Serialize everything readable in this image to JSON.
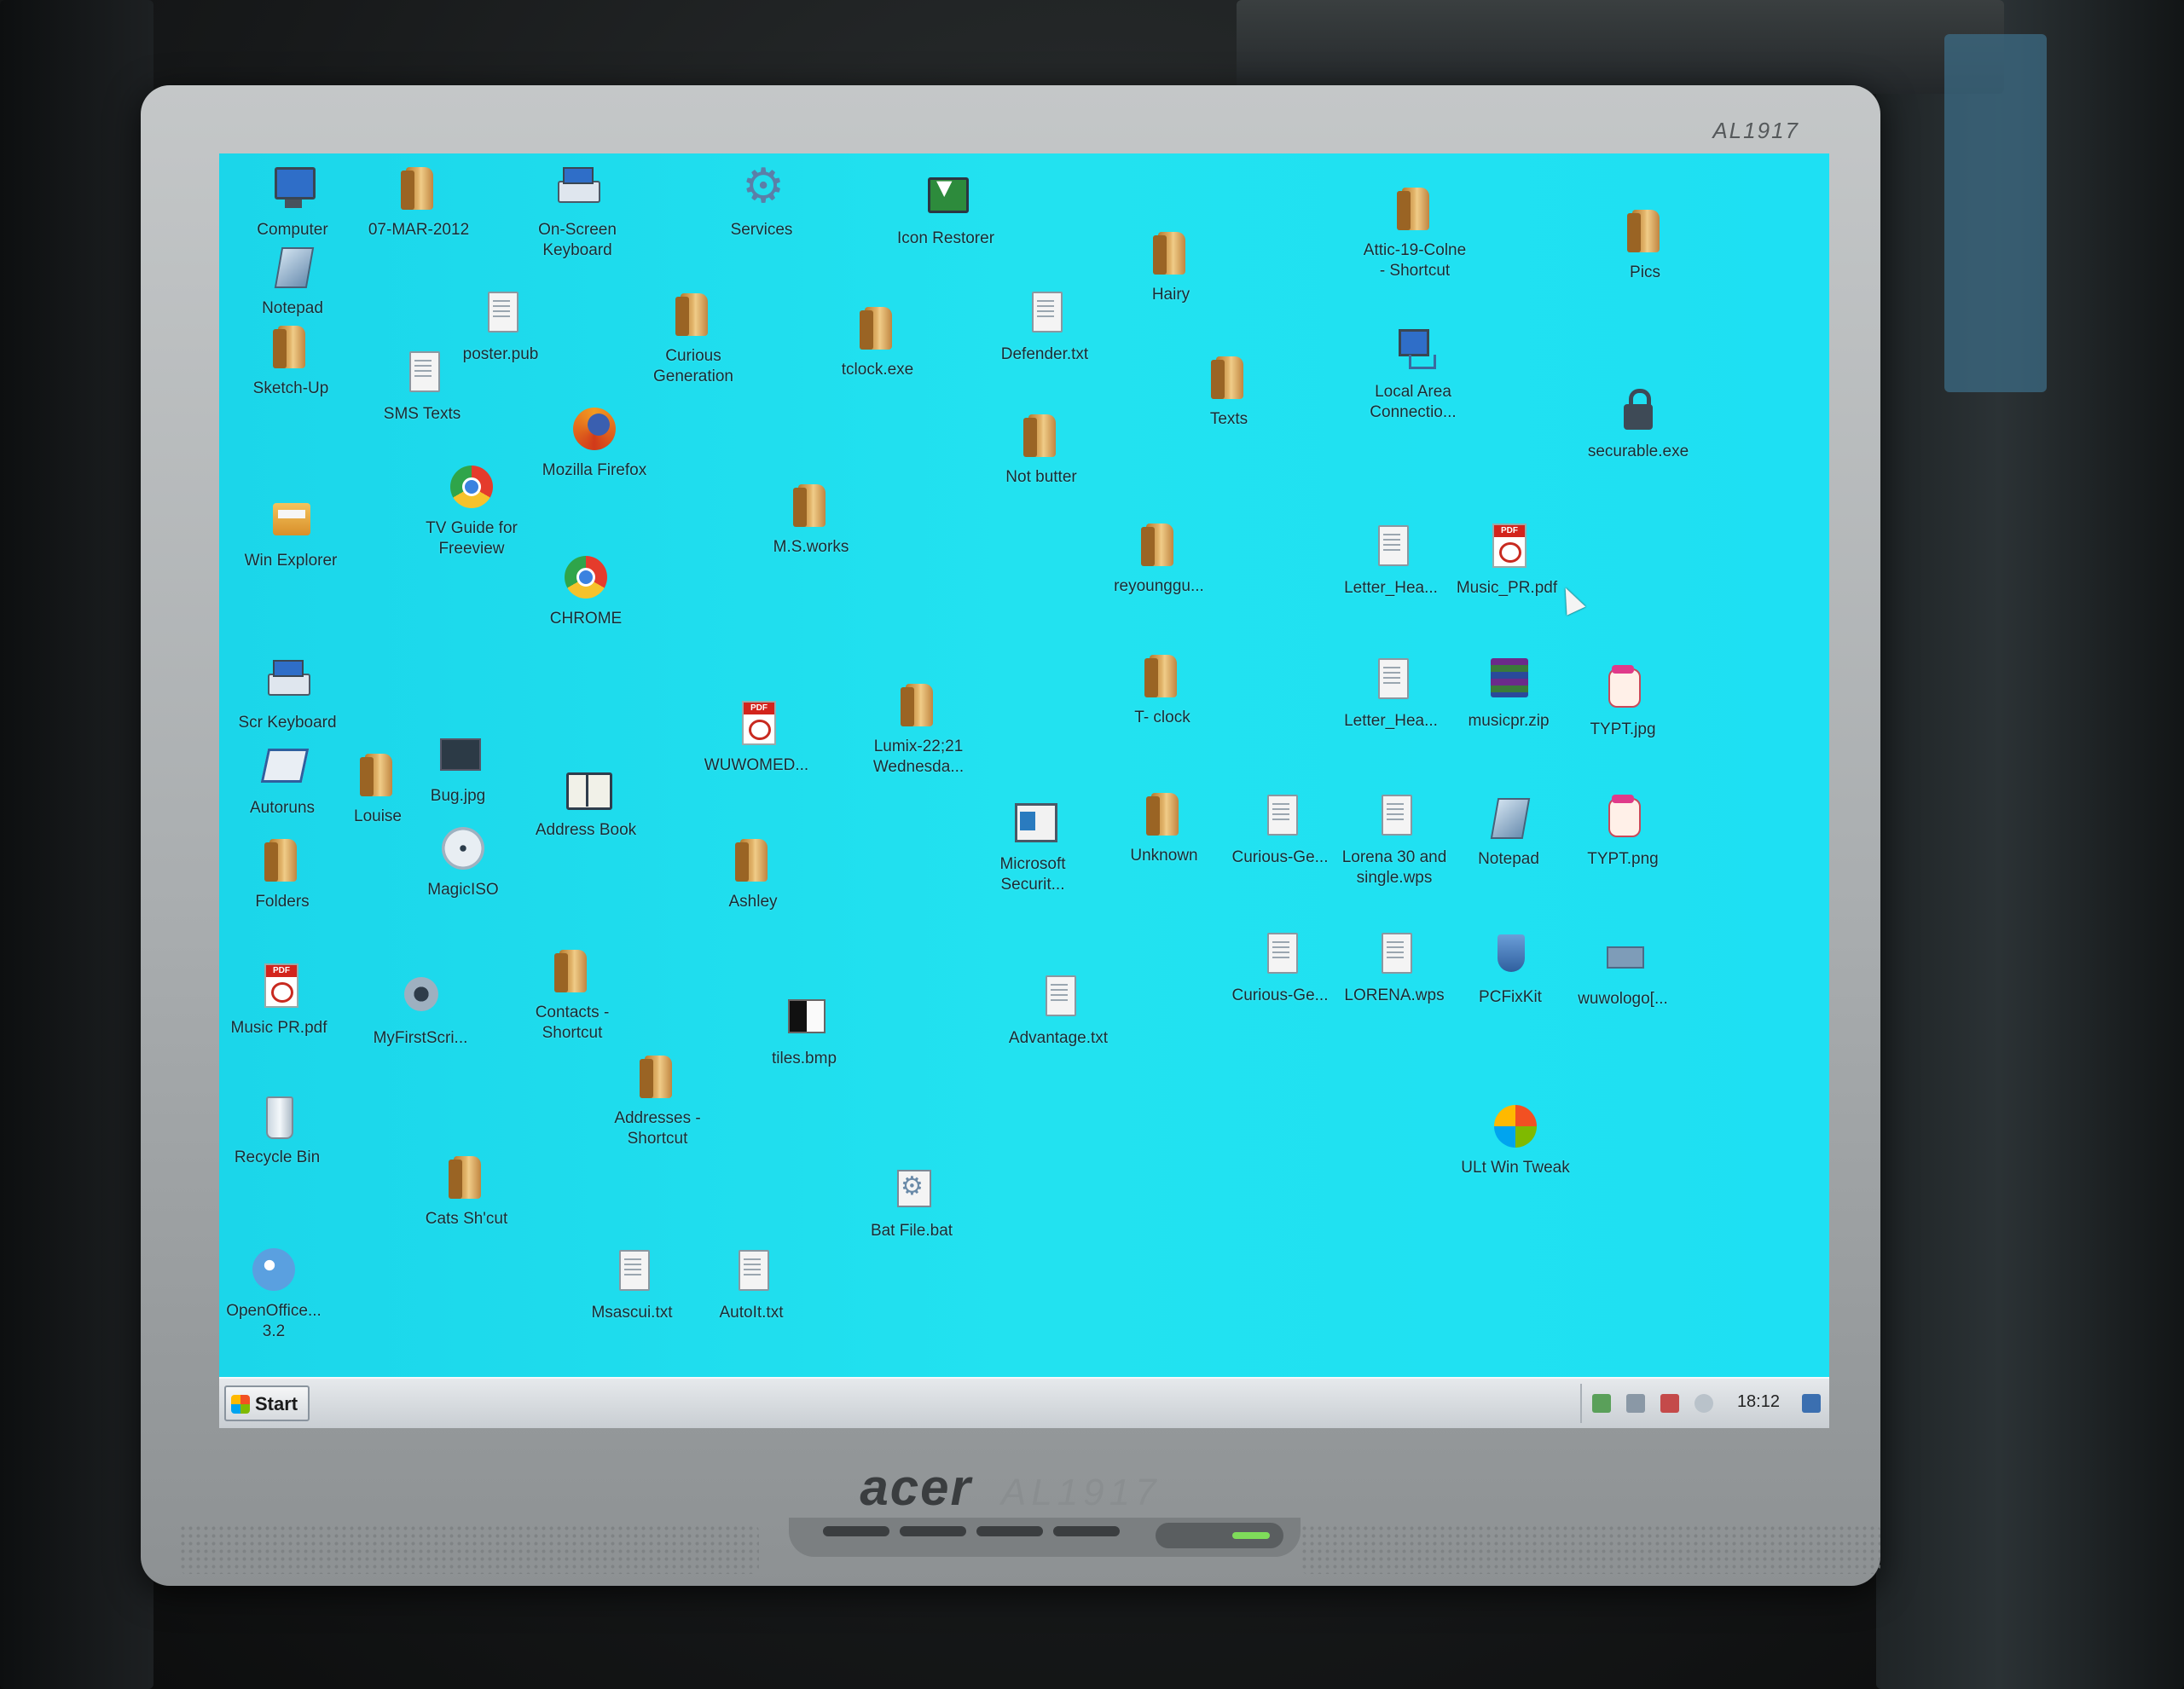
{
  "monitor": {
    "model_top": "AL1917",
    "brand": "acer",
    "model_front": "AL1917"
  },
  "desktop": {
    "icons": {
      "computer": "Computer",
      "notepad_top": "Notepad",
      "sketchup": "Sketch-Up",
      "date_folder": "07-MAR-2012",
      "onscreen_keyboard": "On-Screen\nKeyboard",
      "services": "Services",
      "icon_restorer": "Icon Restorer",
      "attic": "Attic-19-Colne\n- Shortcut",
      "pics": "Pics",
      "poster": "poster.pub",
      "curious_generation": "Curious\nGeneration",
      "tclock": "tclock.exe",
      "defender": "Defender.txt",
      "hairy": "Hairy",
      "sms_texts": "SMS Texts",
      "firefox": "Mozilla Firefox",
      "texts": "Texts",
      "local_area": "Local Area\nConnectio...",
      "securable": "securable.exe",
      "not_butter": "Not butter",
      "win_explorer": "Win Explorer",
      "tv_guide": "TV Guide for\nFreeview",
      "msworks": "M.S.works",
      "reyounggu": "reyounggu...",
      "chrome": "CHROME",
      "letter_head_1": "Letter_Hea...",
      "music_pr_pdf_right": "Music_PR.pdf",
      "scr_keyboard": "Scr Keyboard",
      "autoruns": "Autoruns",
      "louise": "Louise",
      "bug": "Bug.jpg",
      "address_book": "Address Book",
      "wuwomed": "WUWOMED...",
      "lumix": "Lumix-22;21\nWednesda...",
      "tclock_folder": "T- clock",
      "letter_head_2": "Letter_Hea...",
      "musicpr_zip": "musicpr.zip",
      "typt_jpg": "TYPT.jpg",
      "folders": "Folders",
      "magiciso": "MagicISO",
      "ashley": "Ashley",
      "microsoft_security": "Microsoft\nSecurit...",
      "unknown": "Unknown",
      "curious_ge_1": "Curious-Ge...",
      "lorena30": "Lorena 30 and\nsingle.wps",
      "notepad_right": "Notepad",
      "typt_png": "TYPT.png",
      "music_pr_left": "Music PR.pdf",
      "myfirstscript": "MyFirstScri...",
      "contacts": "Contacts -\nShortcut",
      "tiles": "tiles.bmp",
      "advantage": "Advantage.txt",
      "curious_ge_2": "Curious-Ge...",
      "lorena_wps": "LORENA.wps",
      "pcfixkit": "PCFixKit",
      "wuwologo": "wuwologo[...",
      "addresses": "Addresses -\nShortcut",
      "ult_win_tweak": "ULt Win Tweak",
      "recycle_bin": "Recycle Bin",
      "cats": "Cats Sh'cut",
      "bat_file": "Bat File.bat",
      "openoffice": "OpenOffice...\n3.2",
      "msascui": "Msascui.txt",
      "autoit": "AutoIt.txt"
    }
  },
  "taskbar": {
    "start_label": "Start",
    "clock": "18:12"
  }
}
